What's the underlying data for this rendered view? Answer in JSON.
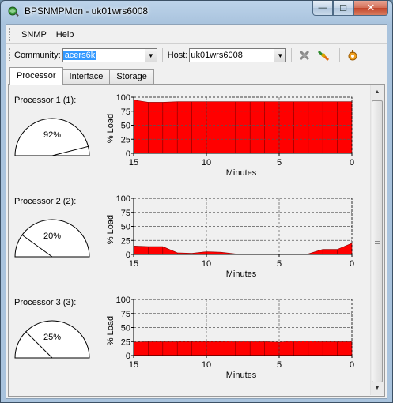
{
  "window": {
    "title": "BPSNMPMon - uk01wrs6008",
    "minimize_glyph": "—",
    "maximize_glyph": "☐",
    "close_glyph": "✕"
  },
  "menu": {
    "items": [
      "SNMP",
      "Help"
    ]
  },
  "toolbar": {
    "community_label": "Community:",
    "community_value": "acers6k",
    "host_label": "Host:",
    "host_value": "uk01wrs6008",
    "icons": [
      "disconnect-icon",
      "connect-icon",
      "settings-icon"
    ]
  },
  "tabs": [
    {
      "label": "Processor",
      "active": true
    },
    {
      "label": "Interface",
      "active": false
    },
    {
      "label": "Storage",
      "active": false
    }
  ],
  "processors": [
    {
      "label": "Processor 1 (1):",
      "gauge_percent": "92%",
      "gauge_value": 92,
      "chart_data": {
        "type": "area",
        "xlabel": "Minutes",
        "ylabel": "% Load",
        "x_ticks": [
          "15",
          "10",
          "5",
          "0"
        ],
        "y_ticks": [
          "0",
          "25",
          "50",
          "75",
          "100"
        ],
        "ylim": [
          0,
          100
        ],
        "xlim": [
          15,
          0
        ],
        "x": [
          15,
          14.5,
          14,
          13,
          12,
          11,
          10,
          9,
          8,
          7,
          6,
          5,
          4,
          3,
          2,
          1,
          0
        ],
        "values": [
          95,
          93,
          91,
          91,
          92,
          92,
          92,
          92,
          92,
          92,
          92,
          92,
          92,
          92,
          92,
          92,
          92
        ],
        "fill": "#ff0000",
        "grid": true
      }
    },
    {
      "label": "Processor 2 (2):",
      "gauge_percent": "20%",
      "gauge_value": 20,
      "chart_data": {
        "type": "area",
        "xlabel": "Minutes",
        "ylabel": "% Load",
        "x_ticks": [
          "15",
          "10",
          "5",
          "0"
        ],
        "y_ticks": [
          "0",
          "25",
          "50",
          "75",
          "100"
        ],
        "ylim": [
          0,
          100
        ],
        "xlim": [
          15,
          0
        ],
        "x": [
          15,
          14,
          13,
          12,
          11,
          10,
          9,
          8,
          7,
          6,
          5,
          4,
          3,
          2,
          1,
          0
        ],
        "values": [
          15,
          14,
          14,
          3,
          2,
          5,
          4,
          1,
          1,
          1,
          1,
          1,
          1,
          9,
          9,
          20
        ],
        "fill": "#ff0000",
        "grid": true
      }
    },
    {
      "label": "Processor 3 (3):",
      "gauge_percent": "25%",
      "gauge_value": 25,
      "chart_data": {
        "type": "area",
        "xlabel": "Minutes",
        "ylabel": "% Load",
        "x_ticks": [
          "15",
          "10",
          "5",
          "0"
        ],
        "y_ticks": [
          "0",
          "25",
          "50",
          "75",
          "100"
        ],
        "ylim": [
          0,
          100
        ],
        "xlim": [
          15,
          0
        ],
        "x": [
          15,
          14,
          13,
          12,
          11,
          10,
          9,
          8,
          7,
          6,
          5,
          4,
          3,
          2,
          1,
          0
        ],
        "values": [
          24,
          25,
          25,
          25,
          25,
          25,
          25,
          26,
          26,
          25,
          24,
          26,
          26,
          25,
          25,
          25
        ],
        "fill": "#ff0000",
        "grid": true
      }
    }
  ]
}
